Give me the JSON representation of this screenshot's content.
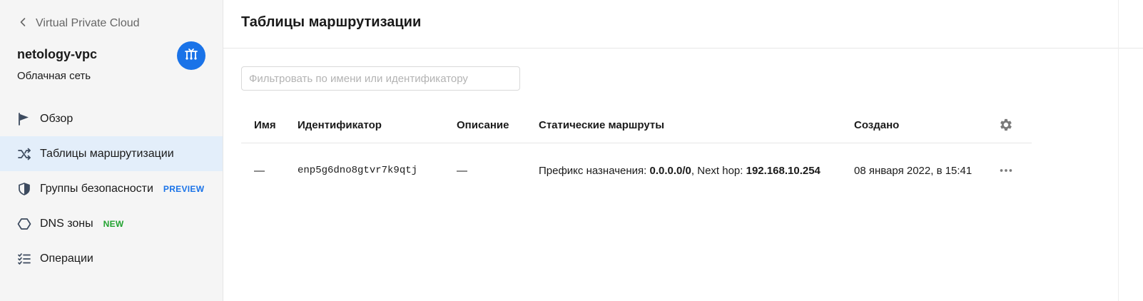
{
  "sidebar": {
    "back_label": "Virtual Private Cloud",
    "vpc_name": "netology-vpc",
    "vpc_type": "Облачная сеть",
    "items": [
      {
        "label": "Обзор",
        "icon": "flag-icon",
        "active": false
      },
      {
        "label": "Таблицы маршрутизации",
        "icon": "shuffle-icon",
        "active": true
      },
      {
        "label": "Группы безопасности",
        "icon": "shield-icon",
        "badge": "PREVIEW",
        "active": false
      },
      {
        "label": "DNS зоны",
        "icon": "hexagon-icon",
        "badge": "NEW",
        "active": false
      },
      {
        "label": "Операции",
        "icon": "checklist-icon",
        "active": false
      }
    ]
  },
  "main": {
    "title": "Таблицы маршрутизации",
    "filter_placeholder": "Фильтровать по имени или идентификатору",
    "filter_value": "",
    "columns": {
      "name": "Имя",
      "id": "Идентификатор",
      "description": "Описание",
      "routes": "Статические маршруты",
      "created": "Создано"
    },
    "rows": [
      {
        "name": "—",
        "id": "enp5g6dno8gtvr7k9qtj",
        "description": "—",
        "routes_prefix_label": "Префикс назначения:",
        "routes_prefix_value": "0.0.0.0/0",
        "routes_sep": ",",
        "routes_hop_label": "Next hop:",
        "routes_hop_value": "192.168.10.254",
        "created": "08 января 2022, в 15:41"
      }
    ]
  },
  "colors": {
    "accent": "#1a73e8",
    "new_badge": "#23a331",
    "active_item_bg": "#e3eefa",
    "sidebar_bg": "#f5f5f5"
  }
}
